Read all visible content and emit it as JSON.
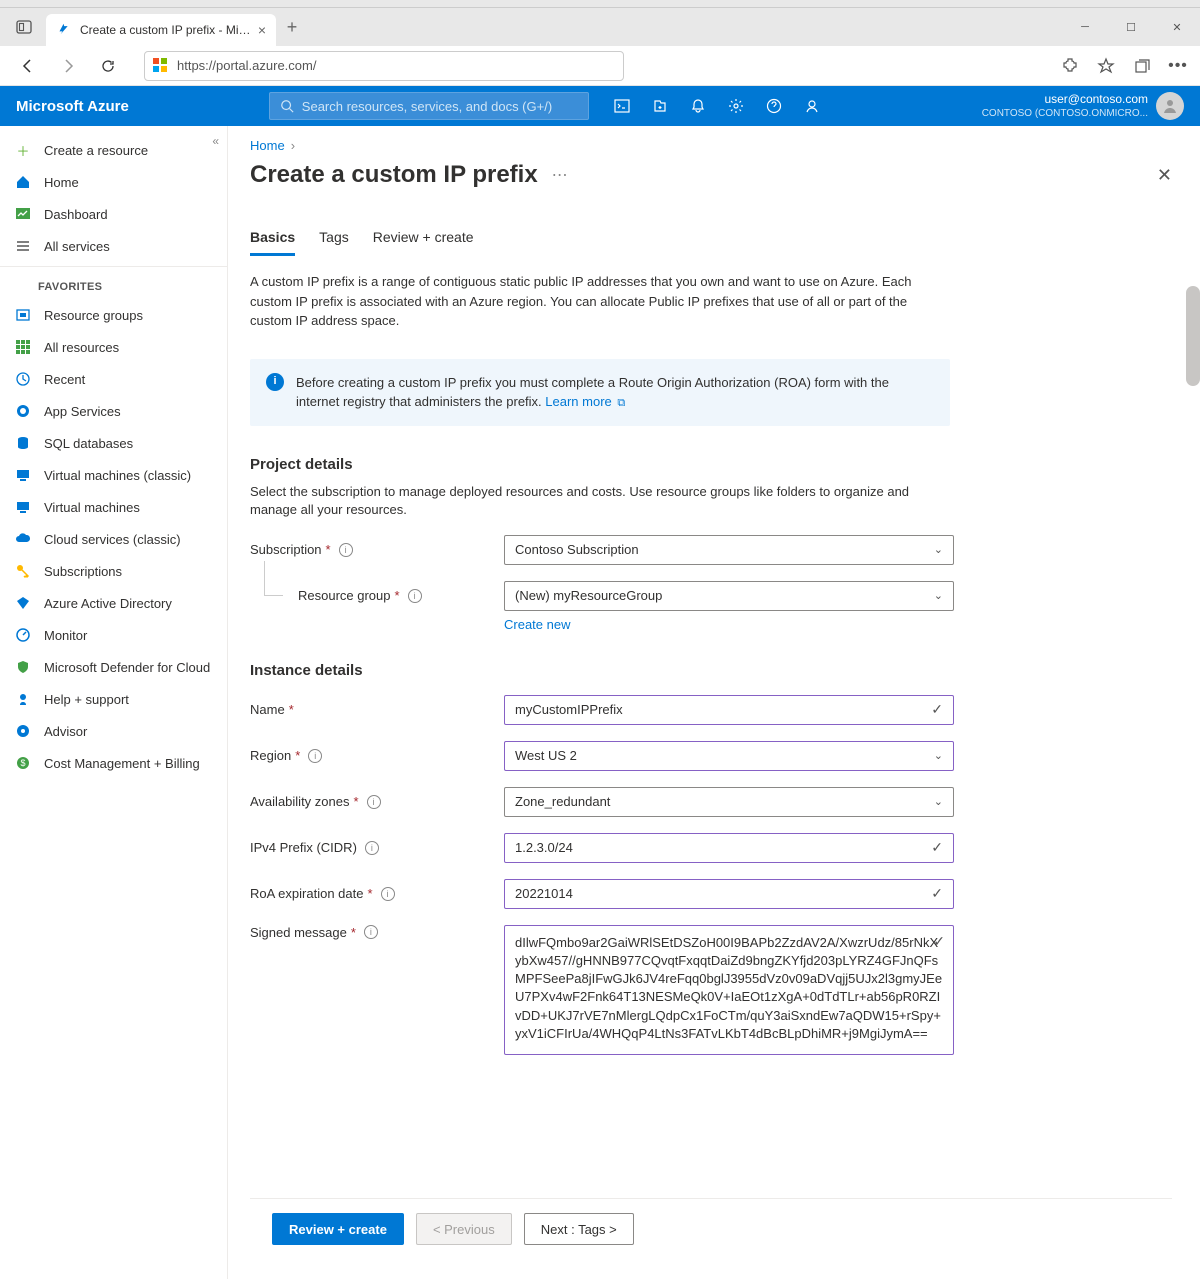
{
  "browser": {
    "tab_title": "Create a custom IP prefix - Micr...",
    "url": "https://portal.azure.com/"
  },
  "azure": {
    "brand": "Microsoft Azure",
    "search_placeholder": "Search resources, services, and docs (G+/)",
    "user_email": "user@contoso.com",
    "user_tenant": "CONTOSO (CONTOSO.ONMICRO..."
  },
  "sidebar": {
    "create": "Create a resource",
    "home": "Home",
    "dashboard": "Dashboard",
    "all_services": "All services",
    "favorites": "FAVORITES",
    "items": [
      "Resource groups",
      "All resources",
      "Recent",
      "App Services",
      "SQL databases",
      "Virtual machines (classic)",
      "Virtual machines",
      "Cloud services (classic)",
      "Subscriptions",
      "Azure Active Directory",
      "Monitor",
      "Microsoft Defender for Cloud",
      "Help + support",
      "Advisor",
      "Cost Management + Billing"
    ]
  },
  "breadcrumb": {
    "home": "Home"
  },
  "page": {
    "title": "Create a custom IP prefix",
    "tabs": {
      "basics": "Basics",
      "tags": "Tags",
      "review": "Review + create"
    },
    "description": "A custom IP prefix is a range of contiguous static public IP addresses that you own and want to use on Azure. Each custom IP prefix is associated with an Azure region. You can allocate Public IP prefixes that use of all or part of the custom IP address space.",
    "info_text": "Before creating a custom IP prefix you must complete a Route Origin Authorization (ROA) form with the internet registry that administers the prefix. ",
    "learn_more": "Learn more",
    "project_details": "Project details",
    "project_desc": "Select the subscription to manage deployed resources and costs. Use resource groups like folders to organize and manage all your resources.",
    "instance_details": "Instance details",
    "labels": {
      "subscription": "Subscription",
      "resource_group": "Resource group",
      "create_new": "Create new",
      "name": "Name",
      "region": "Region",
      "avail_zones": "Availability zones",
      "ipv4": "IPv4 Prefix (CIDR)",
      "roa": "RoA expiration date",
      "signed": "Signed message"
    },
    "values": {
      "subscription": "Contoso Subscription",
      "resource_group": "(New) myResourceGroup",
      "name": "myCustomIPPrefix",
      "region": "West US 2",
      "avail_zones": "Zone_redundant",
      "ipv4": "1.2.3.0/24",
      "roa": "20221014",
      "signed": "dIlwFQmbo9ar2GaiWRlSEtDSZoH00I9BAPb2ZzdAV2A/XwzrUdz/85rNkXybXw457//gHNNB977CQvqtFxqqtDaiZd9bngZKYfjd203pLYRZ4GFJnQFsMPFSeePa8jIFwGJk6JV4reFqq0bglJ3955dVz0v09aDVqjj5UJx2l3gmyJEeU7PXv4wF2Fnk64T13NESMeQk0V+IaEOt1zXgA+0dTdTLr+ab56pR0RZIvDD+UKJ7rVE7nMlergLQdpCx1FoCTm/quY3aiSxndEw7aQDW15+rSpy+yxV1iCFIrUa/4WHQqP4LtNs3FATvLKbT4dBcBLpDhiMR+j9MgiJymA=="
    }
  },
  "footer": {
    "review": "Review + create",
    "previous": "< Previous",
    "next": "Next : Tags >"
  }
}
